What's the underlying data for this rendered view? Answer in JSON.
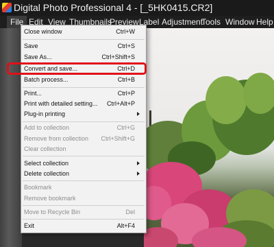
{
  "titlebar": {
    "title": "Digital Photo Professional 4 - [_5HK0415.CR2]"
  },
  "menubar": {
    "items": [
      "File",
      "Edit",
      "View",
      "Thumbnails",
      "Preview",
      "Label",
      "Adjustment",
      "Tools",
      "Window",
      "Help"
    ]
  },
  "file_menu": {
    "items": [
      {
        "label": "Close window",
        "shortcut": "Ctrl+W",
        "enabled": true
      },
      {
        "label": "Save",
        "shortcut": "Ctrl+S",
        "enabled": true
      },
      {
        "label": "Save As...",
        "shortcut": "Ctrl+Shift+S",
        "enabled": true
      },
      {
        "label": "Convert and save...",
        "shortcut": "Ctrl+D",
        "enabled": true,
        "highlighted": true
      },
      {
        "label": "Batch process...",
        "shortcut": "Ctrl+B",
        "enabled": true
      },
      {
        "label": "Print...",
        "shortcut": "Ctrl+P",
        "enabled": true
      },
      {
        "label": "Print with detailed setting...",
        "shortcut": "Ctrl+Alt+P",
        "enabled": true
      },
      {
        "label": "Plug-in printing",
        "shortcut": "",
        "enabled": true,
        "submenu": true
      },
      {
        "label": "Add to collection",
        "shortcut": "Ctrl+G",
        "enabled": false
      },
      {
        "label": "Remove from collection",
        "shortcut": "Ctrl+Shift+G",
        "enabled": false
      },
      {
        "label": "Clear collection",
        "shortcut": "",
        "enabled": false
      },
      {
        "label": "Select collection",
        "shortcut": "",
        "enabled": true,
        "submenu": true
      },
      {
        "label": "Delete collection",
        "shortcut": "",
        "enabled": true,
        "submenu": true
      },
      {
        "label": "Bookmark",
        "shortcut": "",
        "enabled": false
      },
      {
        "label": "Remove bookmark",
        "shortcut": "",
        "enabled": false
      },
      {
        "label": "Move to Recycle Bin",
        "shortcut": "Del",
        "enabled": false
      },
      {
        "label": "Exit",
        "shortcut": "Alt+F4",
        "enabled": true
      }
    ]
  },
  "colors": {
    "highlight_border": "#e0101a",
    "menu_bg": "#f2f2f2",
    "titlebar_bg": "#1a1a1a"
  }
}
